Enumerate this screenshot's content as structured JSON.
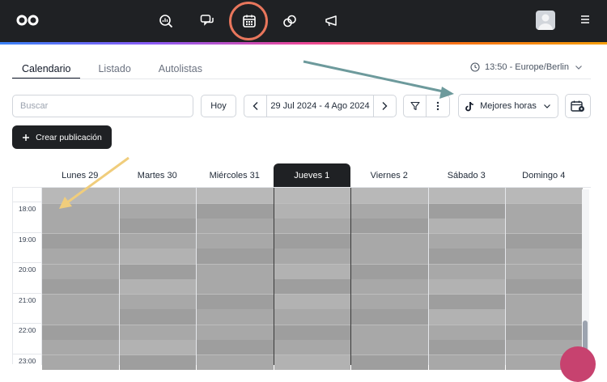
{
  "topbar": {
    "nav_icons": [
      "analytics-icon",
      "inbox-icon",
      "calendar-icon",
      "links-icon",
      "megaphone-icon"
    ],
    "active_icon": "calendar-icon",
    "gradient_colors": [
      "#3b82f6",
      "#8b5cf6",
      "#ec4899",
      "#f97316",
      "#f59e0b"
    ]
  },
  "tabs": {
    "calendario": "Calendario",
    "listado": "Listado",
    "autolistas": "Autolistas",
    "active": "Calendario"
  },
  "timezone": "13:50 - Europe/Berlin",
  "toolbar": {
    "search_placeholder": "Buscar",
    "today_label": "Hoy",
    "date_range": "29 Jul 2024 - 4 Ago 2024",
    "best_hours_label": "Mejores horas",
    "create_label": "Crear publicación"
  },
  "calendar": {
    "days": [
      "Lunes 29",
      "Martes 30",
      "Miércoles 31",
      "Jueves 1",
      "Viernes 2",
      "Sábado 3",
      "Domingo 4"
    ],
    "today": "Jueves 1",
    "hours": [
      "18:00",
      "19:00",
      "20:00",
      "21:00",
      "22:00",
      "23:00"
    ]
  },
  "colors": {
    "topbar_bg": "#1f2124",
    "highlight_ring": "#e8765c",
    "annotation_teal": "#6d9a9c",
    "annotation_yellow": "#f0cd7c",
    "fab": "#c7426f"
  }
}
